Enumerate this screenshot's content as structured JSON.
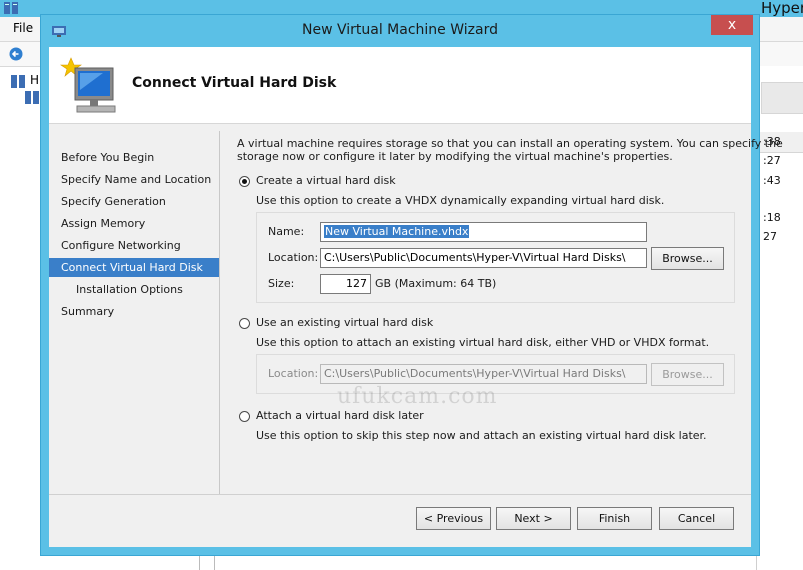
{
  "background_app": {
    "title": "Hyper-",
    "menu": {
      "file": "File"
    },
    "tree": {
      "root_label": "H"
    },
    "times": [
      ":38",
      ":27",
      ":43",
      ":18",
      "27"
    ]
  },
  "wizard": {
    "title": "New Virtual Machine Wizard",
    "close_symbol": "x",
    "header_title": "Connect Virtual Hard Disk",
    "nav": [
      "Before You Begin",
      "Specify Name and Location",
      "Specify Generation",
      "Assign Memory",
      "Configure Networking",
      "Connect Virtual Hard Disk",
      "Installation Options",
      "Summary"
    ],
    "active_nav": "Connect Virtual Hard Disk",
    "intro_line1": "A virtual machine requires storage so that you can install an operating system. You can specify the",
    "intro_line2": "storage now or configure it later by modifying the virtual machine's properties.",
    "option_create": {
      "label": "Create a virtual hard disk",
      "selected": true,
      "description": "Use this option to create a VHDX dynamically expanding virtual hard disk.",
      "name_label": "Name:",
      "name_value": "New Virtual Machine.vhdx",
      "location_label": "Location:",
      "location_value": "C:\\Users\\Public\\Documents\\Hyper-V\\Virtual Hard Disks\\",
      "browse_label": "Browse...",
      "size_label": "Size:",
      "size_value": "127",
      "size_unit": "GB (Maximum: 64 TB)"
    },
    "option_existing": {
      "label": "Use an existing virtual hard disk",
      "selected": false,
      "description": "Use this option to attach an existing virtual hard disk, either VHD or VHDX format.",
      "location_label": "Location:",
      "location_value": "C:\\Users\\Public\\Documents\\Hyper-V\\Virtual Hard Disks\\",
      "browse_label": "Browse..."
    },
    "option_later": {
      "label": "Attach a virtual hard disk later",
      "selected": false,
      "description": "Use this option to skip this step now and attach an existing virtual hard disk later."
    },
    "watermark": "ufukcam.com",
    "buttons": {
      "previous": "< Previous",
      "next": "Next >",
      "finish": "Finish",
      "cancel": "Cancel"
    }
  },
  "colors": {
    "title_bar": "#5bc0e6",
    "close_button": "#c74f4f",
    "selection": "#3a7fc9"
  }
}
